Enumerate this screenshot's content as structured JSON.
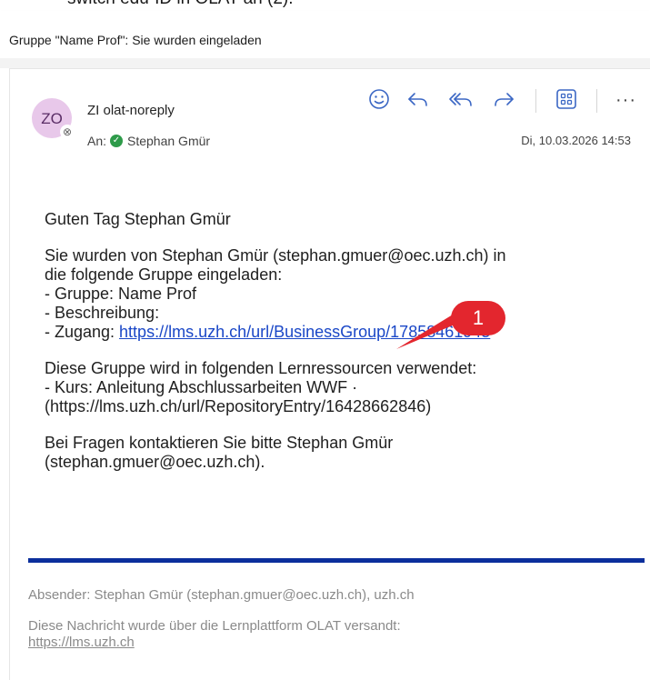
{
  "top_fragment": "switch edu-ID in OLAT an (2).",
  "subject": "Gruppe \"Name Prof\": Sie wurden eingeladen",
  "message": {
    "avatar_initials": "ZO",
    "sender": "ZI olat-noreply",
    "to_label": "An:",
    "to_name": "Stephan Gmür",
    "date": "Di, 10.03.2026 14:53"
  },
  "toolbar": {
    "icons": [
      "emoji-icon",
      "reply-icon",
      "reply-all-icon",
      "forward-icon",
      "apps-icon",
      "more-icon"
    ],
    "more_label": "···"
  },
  "body": {
    "greeting": "Guten Tag Stephan Gmür",
    "invite_line1": "Sie wurden von Stephan Gmür (stephan.gmuer@oec.uzh.ch) in",
    "invite_line2": "die folgende Gruppe eingeladen:",
    "group_line": "- Gruppe: Name Prof",
    "description_line": "- Beschreibung:",
    "access_prefix": "- Zugang: ",
    "access_link": "https://lms.uzh.ch/url/BusinessGroup/17858461945",
    "resources_line1": "Diese Gruppe wird in folgenden Lernressourcen verwendet:",
    "resources_line2": "- Kurs: Anleitung Abschlussarbeiten WWF ·",
    "resources_line3": "(https://lms.uzh.ch/url/RepositoryEntry/16428662846)",
    "questions_line1": "Bei Fragen kontaktieren Sie bitte Stephan Gmür",
    "questions_line2": "(stephan.gmuer@oec.uzh.ch)."
  },
  "footer": {
    "sender_line": "Absender: Stephan Gmür (stephan.gmuer@oec.uzh.ch), uzh.ch",
    "sent_line": "Diese Nachricht wurde über die Lernplattform OLAT versandt:",
    "sent_link": "https://lms.uzh.ch"
  },
  "annotation": {
    "number": "1",
    "color": "#e3262e"
  },
  "colors": {
    "accent": "#3b67c4",
    "link": "#1a47c7",
    "divider": "#0b2f9c",
    "avatar_bg": "#e8c8ea"
  }
}
